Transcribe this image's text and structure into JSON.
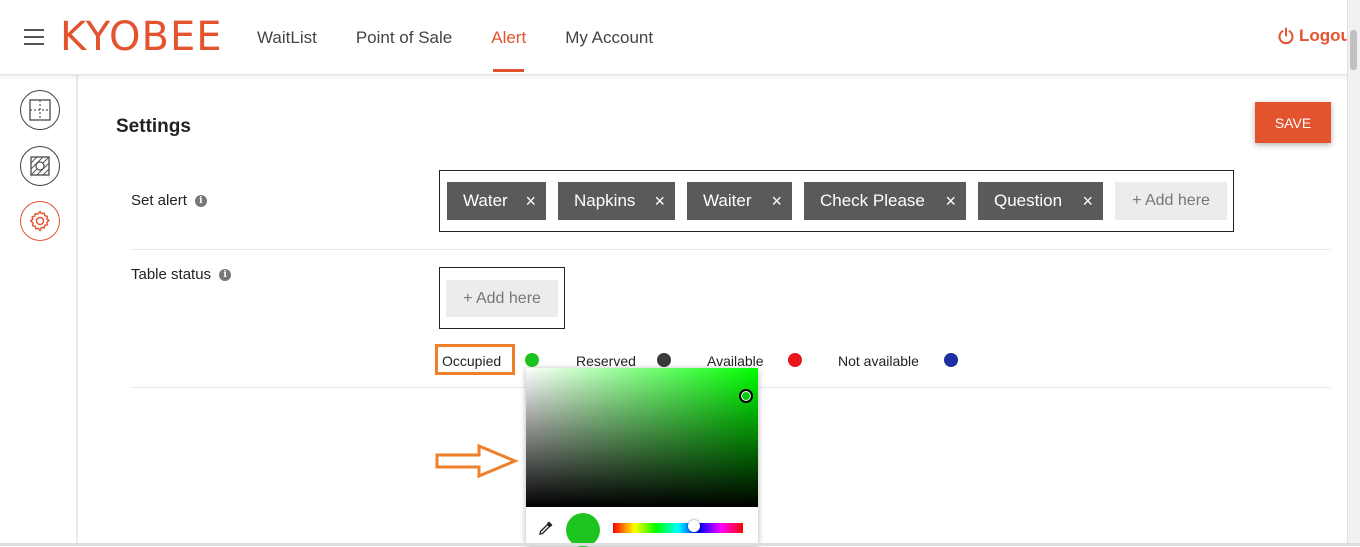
{
  "header": {
    "logo": "KYOBEE",
    "nav": [
      "WaitList",
      "Point of Sale",
      "Alert",
      "My Account"
    ],
    "active_nav": "Alert",
    "logout": "Logou"
  },
  "sidebar": {
    "items": [
      "floor-plan",
      "table-layout",
      "settings"
    ],
    "active": "settings"
  },
  "main": {
    "title": "Settings",
    "save": "SAVE",
    "set_alert": {
      "label": "Set alert",
      "info": "i",
      "chips": [
        "Water",
        "Napkins",
        "Waiter",
        "Check Please",
        "Question"
      ],
      "chip_close": "×",
      "add": "+ Add here"
    },
    "table_status": {
      "label": "Table status",
      "info": "i",
      "add": "+ Add here",
      "statuses": [
        {
          "label": "Occupied",
          "color": "#1ec51e"
        },
        {
          "label": "Reserved",
          "color": "#3a3a3a"
        },
        {
          "label": "Available",
          "color": "#e8141e"
        },
        {
          "label": "Not available",
          "color": "#1f2fa3"
        }
      ]
    }
  },
  "color_picker": {
    "hue_color": "#00ff00",
    "selected_color": "#1ec51e"
  },
  "colors": {
    "accent": "#e2532e",
    "chip_bg": "#5a5a5a",
    "highlight": "#f07f2a"
  }
}
